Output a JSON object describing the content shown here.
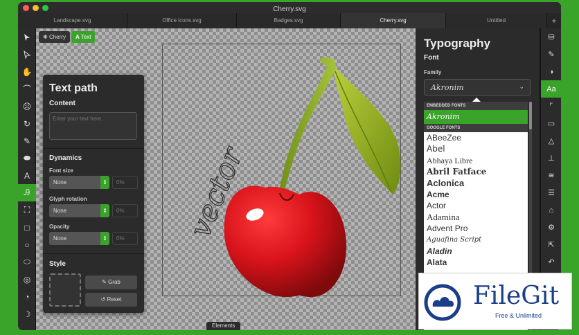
{
  "window": {
    "title": "Cherry.svg"
  },
  "tabs": [
    "Landscape.svg",
    "Office icons.svg",
    "Badges.svg",
    "Cherry.svg",
    "Untitled"
  ],
  "tab_add": "+",
  "breadcrumb": {
    "item1": "Cherry",
    "item2": "Text"
  },
  "text_path": {
    "title": "Text path",
    "content_label": "Content",
    "content_placeholder": "Enter your text here.",
    "dynamics_label": "Dynamics",
    "font_size_label": "Font size",
    "font_size_value": "None",
    "font_size_pct": "0%",
    "glyph_rotation_label": "Glyph rotation",
    "glyph_rotation_value": "None",
    "glyph_rotation_pct": "0%",
    "opacity_label": "Opacity",
    "opacity_value": "None",
    "opacity_pct": "0%",
    "style_label": "Style",
    "grab_label": "Grab",
    "reset_label": "Reset"
  },
  "elements_label": "Elements",
  "canvas_text": "vector",
  "typography": {
    "title": "Typography",
    "font_label": "Font",
    "family_label": "Family",
    "family_value": "Akronim",
    "embedded_header": "EMBEDDED FONTS",
    "embedded_selected": "Akronim",
    "google_header": "GOOGLE FONTS",
    "google_fonts": [
      "ABeeZee",
      "Abel",
      "Abhaya Libre",
      "Abril Fatface",
      "Aclonica",
      "Acme",
      "Actor",
      "Adamina",
      "Advent Pro",
      "Aguafina Script",
      "Aladin",
      "Alata"
    ]
  },
  "watermark": {
    "brand": "FileGit",
    "tagline": "Free & Unlimited"
  },
  "colors": {
    "accent": "#3aa32a",
    "cherry": "#d8131b",
    "leaf": "#8fab1a"
  }
}
